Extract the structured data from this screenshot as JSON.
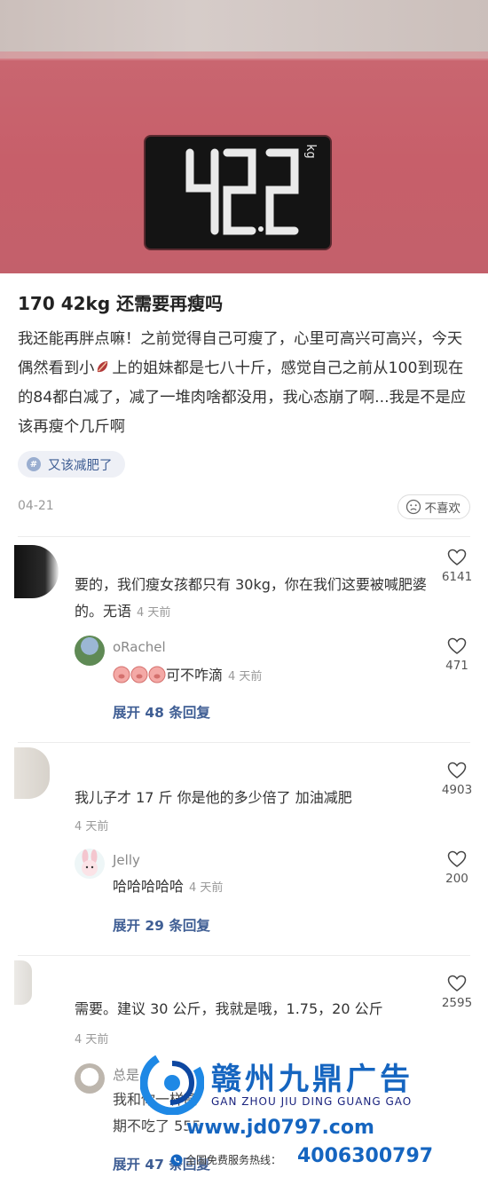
{
  "hero": {
    "scale_reading": "42.2",
    "scale_unit": "kg"
  },
  "post": {
    "title": "170 42kg 还需要再瘦吗",
    "body_part1": "我还能再胖点嘛！之前觉得自己可瘦了，心里可高兴可高兴，今天偶然看到小",
    "body_part2": "上的姐妹都是七八十斤，感觉自己之前从100到现在的84都白减了，减了一堆肉啥都没用，我心态崩了啊...我是不是应该再瘦个几斤啊",
    "tag": "又该减肥了",
    "date": "04-21",
    "dislike_label": "不喜欢"
  },
  "comments": [
    {
      "text": "要的，我们瘦女孩都只有 30kg，你在我们这要被喊肥婆的。无语",
      "time": "4 天前",
      "likes": "6141",
      "reply": {
        "name": "oRachel",
        "text": "可不咋滴",
        "time": "4 天前",
        "likes": "471"
      },
      "expand": "展开 48 条回复"
    },
    {
      "text": "我儿子才 17 斤 你是他的多少倍了 加油减肥",
      "time": "4 天前",
      "likes": "4903",
      "reply": {
        "name": "Jelly",
        "text": "哈哈哈哈哈",
        "time": "4 天前",
        "likes": "200"
      },
      "expand": "展开 29 条回复"
    },
    {
      "text": "需要。建议 30 公斤，我就是哦，1.75，20 公斤",
      "time": "4 天前",
      "likes": "2595",
      "reply": {
        "name": "总是",
        "line1": "我和你一样高",
        "line2": "期不吃了 555"
      },
      "expand": "展开 47 条回复"
    }
  ],
  "watermark": {
    "name_cn": "赣州九鼎广告",
    "pinyin": "GAN ZHOU JIU DING GUANG GAO",
    "url": "www.jd0797.com",
    "hotline_label": "全国免费服务热线：",
    "phone": "4006300797"
  },
  "colors": {
    "scale_pink": "#c75f6a",
    "link_blue": "#3f5e94",
    "watermark_blue": "#1565c0"
  }
}
